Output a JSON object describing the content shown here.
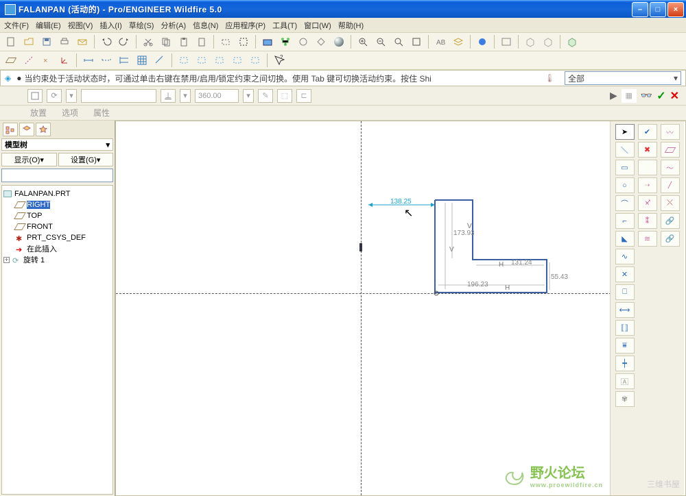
{
  "titlebar": {
    "text": "FALANPAN (活动的) - Pro/ENGINEER Wildfire 5.0"
  },
  "menu": {
    "file": "文件(F)",
    "edit": "编辑(E)",
    "view": "视图(V)",
    "insert": "插入(I)",
    "sketch": "草绘(S)",
    "analysis": "分析(A)",
    "info": "信息(N)",
    "apps": "应用程序(P)",
    "tools": "工具(T)",
    "window": "窗口(W)",
    "help": "帮助(H)"
  },
  "hint": {
    "text": "当约束处于活动状态时，可通过单击右键在禁用/启用/锁定约束之间切换。使用 Tab 键可切换活动约束。按住 Shi"
  },
  "filter": {
    "label": "全部"
  },
  "dash": {
    "angle": "360.00",
    "tabs": {
      "place": "放置",
      "options": "选项",
      "props": "属性"
    }
  },
  "tree": {
    "header": "模型树",
    "show": "显示(O)",
    "settings": "设置(G)",
    "root": "FALANPAN.PRT",
    "right": "RIGHT",
    "top": "TOP",
    "front": "FRONT",
    "csys": "PRT_CSYS_DEF",
    "insert_here": "在此插入",
    "revolve": "旋转 1"
  },
  "sketch": {
    "dims": {
      "d1": "138.25",
      "d2": "173.93",
      "d3": "131.24",
      "d4": "55.43",
      "d5": "196.23"
    },
    "constraints": {
      "h": "H",
      "v": "V"
    }
  },
  "watermark": {
    "name": "野火论坛",
    "url": "www.proewildfire.cn"
  },
  "corner": "三维书屋"
}
